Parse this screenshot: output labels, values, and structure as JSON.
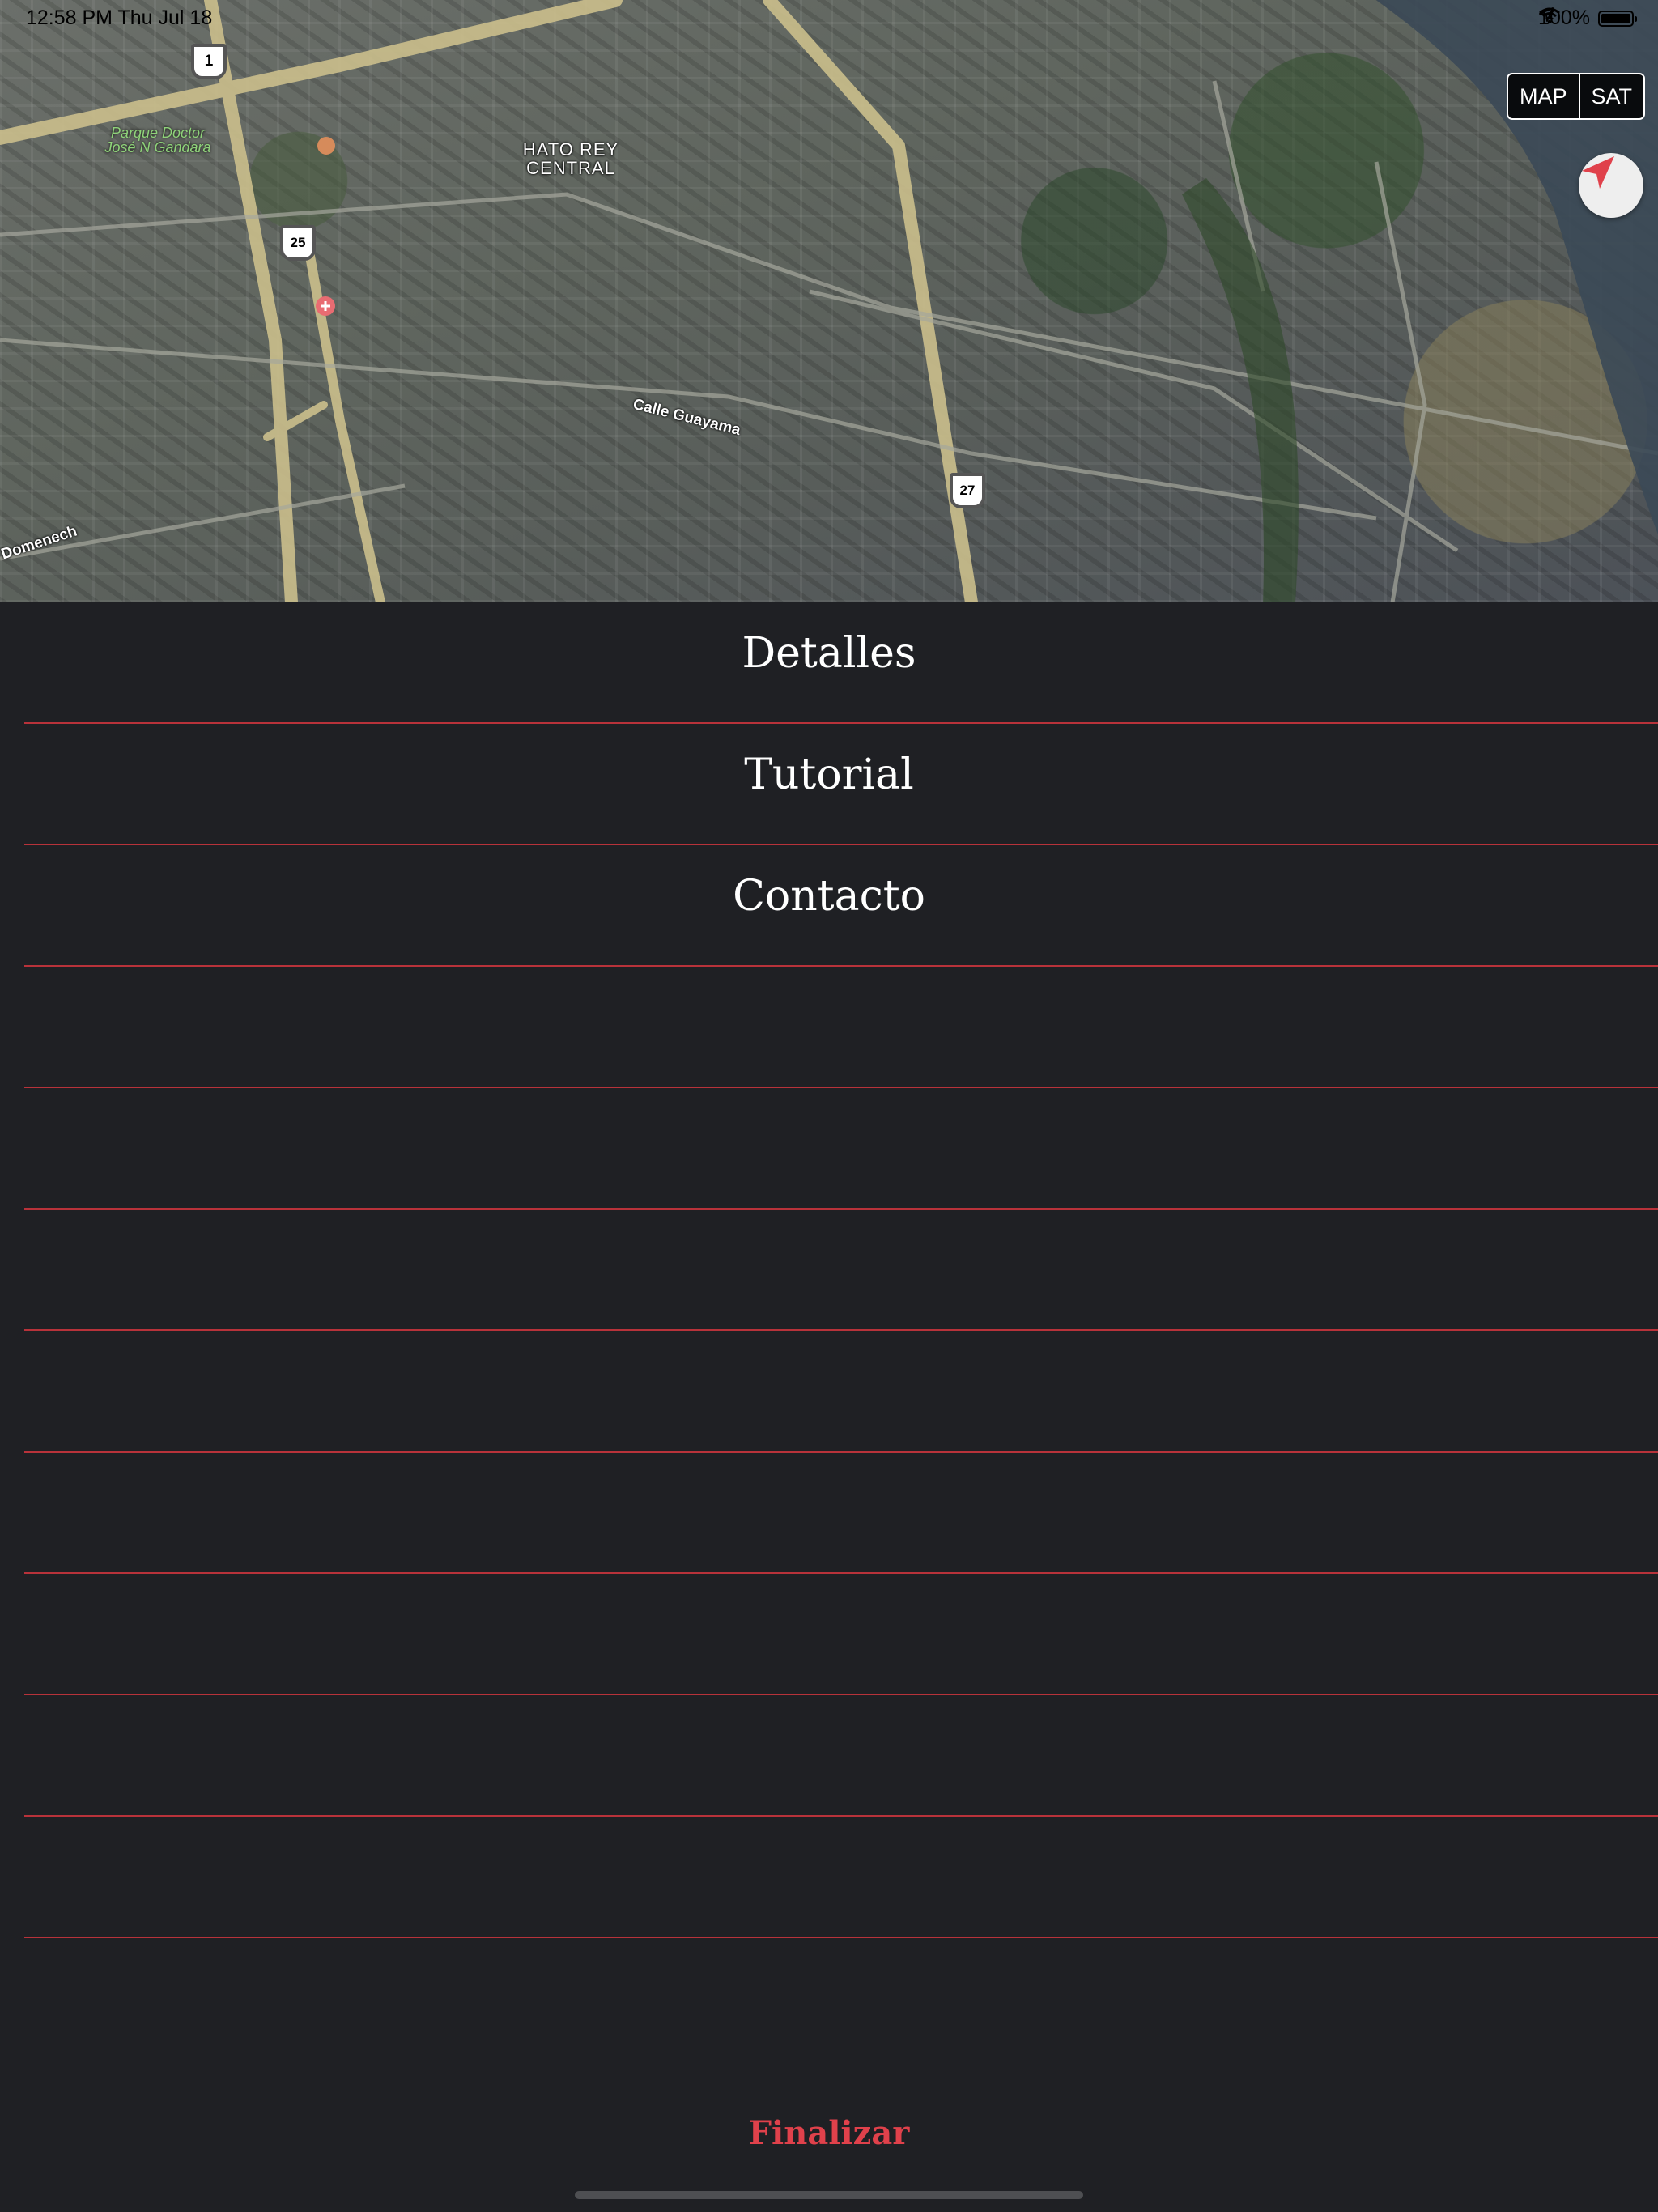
{
  "status_bar": {
    "time": "12:58 PM  Thu Jul 18",
    "battery": "100%"
  },
  "map": {
    "type_control": {
      "map_label": "MAP",
      "sat_label": "SAT"
    },
    "labels": {
      "district": "HATO REY CENTRAL",
      "park": "Parque Doctor José N Gandara",
      "street_1": "Calle Guayama",
      "street_2": "Domenech"
    },
    "shields": {
      "s1": "1",
      "s2": "25",
      "s3": "27"
    },
    "icons": {
      "locate": "location-arrow-icon"
    },
    "accent_color": "#e0414b"
  },
  "menu": {
    "items": [
      {
        "label": "Detalles"
      },
      {
        "label": "Tutorial"
      },
      {
        "label": "Contacto"
      },
      {
        "label": ""
      },
      {
        "label": ""
      },
      {
        "label": ""
      },
      {
        "label": ""
      },
      {
        "label": ""
      },
      {
        "label": ""
      },
      {
        "label": ""
      },
      {
        "label": ""
      }
    ],
    "separator_color": "#b8323a"
  },
  "footer": {
    "finalize_label": "Finalizar"
  }
}
